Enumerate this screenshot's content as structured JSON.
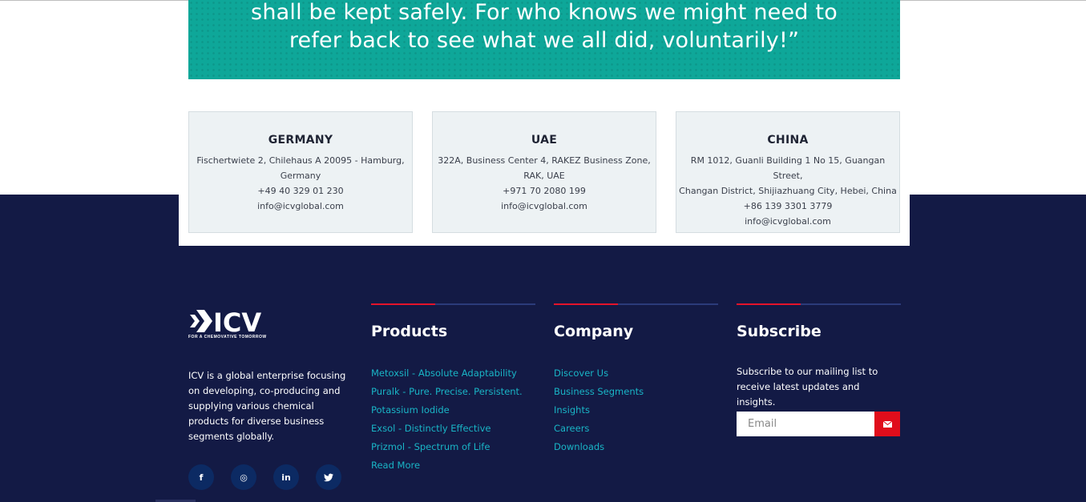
{
  "quote": {
    "line1": "shall be kept safely. For who knows we might need to",
    "line2": "refer back to see what we all did, voluntarily!”"
  },
  "offices": [
    {
      "country": "GERMANY",
      "address_line1": "Fischertwiete 2, Chilehaus A 20095 - Hamburg,",
      "address_line2": "Germany",
      "phone": "+49 40 329 01 230",
      "email": "info@icvglobal.com"
    },
    {
      "country": "UAE",
      "address_line1": "322A, Business Center 4, RAKEZ Business Zone,",
      "address_line2": "RAK, UAE",
      "phone": "+971 70 2080 199",
      "email": "info@icvglobal.com"
    },
    {
      "country": "CHINA",
      "address_line1": "RM 1012, Guanli Building 1 No 15, Guangan Street,",
      "address_line2": "Changan District, Shijiazhuang City, Hebei, China",
      "phone": "+86 139 3301 3779",
      "email": "info@icvglobal.com"
    }
  ],
  "brand": {
    "logo_text": "ICV",
    "tagline": "FOR A CHEMOVATIVE TOMORROW",
    "about": "ICV is a global enterprise focusing on developing, co-producing and supplying various chemical products for diverse business segments globally."
  },
  "socials": [
    {
      "name": "facebook-icon",
      "glyph": "f"
    },
    {
      "name": "instagram-icon",
      "glyph": "◎"
    },
    {
      "name": "linkedin-icon",
      "glyph": "in"
    },
    {
      "name": "twitter-icon",
      "glyph": "🐦"
    }
  ],
  "products": {
    "title": "Products",
    "links": [
      "Metoxsil - Absolute Adaptability",
      "Puralk - Pure. Precise. Persistent.",
      "Potassium Iodide",
      "Exsol - Distinctly Effective",
      "Prizmol - Spectrum of Life",
      "Read More"
    ]
  },
  "company": {
    "title": "Company",
    "links": [
      "Discover Us",
      "Business Segments",
      "Insights",
      "Careers",
      "Downloads"
    ]
  },
  "subscribe": {
    "title": "Subscribe",
    "text": "Subscribe to our mailing list to receive latest updates and insights.",
    "placeholder": "Email",
    "button_icon": "envelope-icon"
  },
  "colors": {
    "banner": "#0ea799",
    "footer": "#131a45",
    "accent_red": "#e4132a",
    "link": "#19b5c6"
  }
}
